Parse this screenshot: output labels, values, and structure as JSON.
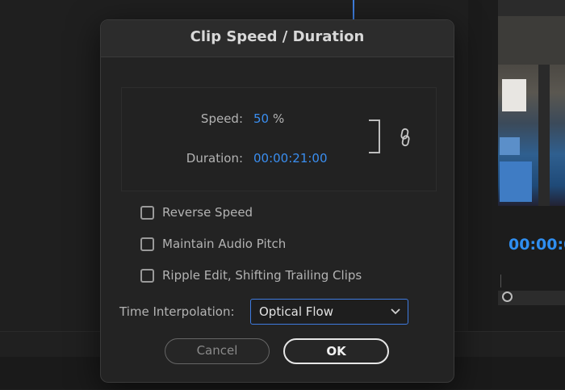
{
  "dialog": {
    "title": "Clip Speed / Duration",
    "speed_label": "Speed:",
    "speed_value": "50",
    "speed_unit": "%",
    "duration_label": "Duration:",
    "duration_value": "00:00:21:00",
    "checkboxes": [
      {
        "label": "Reverse Speed",
        "checked": false
      },
      {
        "label": "Maintain Audio Pitch",
        "checked": false
      },
      {
        "label": "Ripple Edit, Shifting Trailing Clips",
        "checked": false
      }
    ],
    "interpolation_label": "Time Interpolation:",
    "interpolation_value": "Optical Flow",
    "cancel_label": "Cancel",
    "ok_label": "OK"
  },
  "background": {
    "timecode": "00:00:0"
  },
  "colors": {
    "accent_blue": "#3a8ef0",
    "dialog_bg": "#232323",
    "select_border": "#3e7be0"
  },
  "icons": {
    "link": "link-icon",
    "dropdown": "chevron-down-icon"
  }
}
